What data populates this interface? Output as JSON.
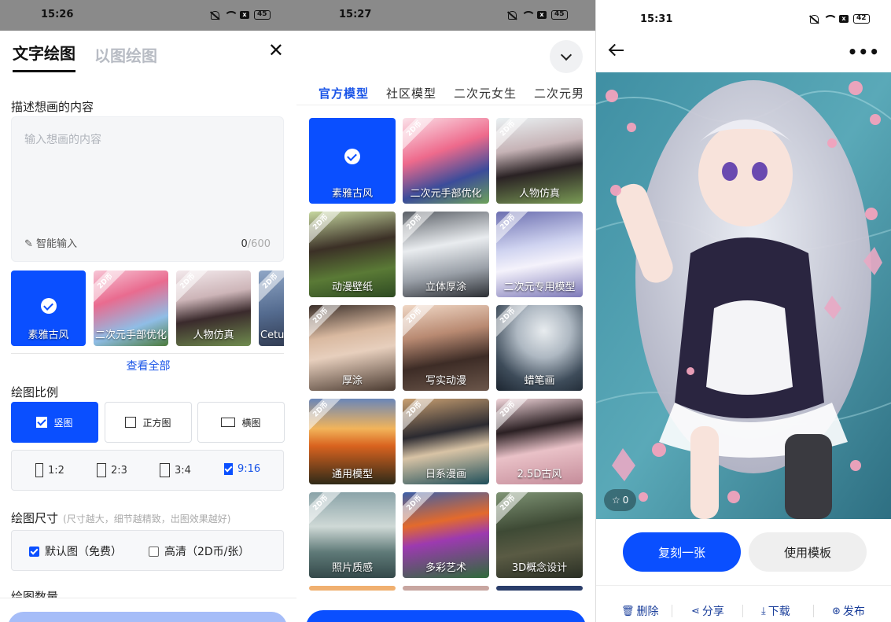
{
  "panel1": {
    "status": {
      "time": "15:26",
      "battery": "45"
    },
    "tabs": [
      "文字绘图",
      "以图绘图"
    ],
    "close_icon": "close-icon",
    "describe_label": "描述想画的内容",
    "input_placeholder": "输入想画的内容",
    "smart_input": "智能输入",
    "char_count": "0",
    "char_max": "/600",
    "models": [
      {
        "name": "素雅古风",
        "selected": true,
        "badge": ""
      },
      {
        "name": "二次元手部优化",
        "selected": false,
        "badge": "2D币"
      },
      {
        "name": "人物仿真",
        "selected": false,
        "badge": "2D币"
      },
      {
        "name": "Cetus",
        "selected": false,
        "badge": "2D币"
      }
    ],
    "view_all": "查看全部",
    "ratio_label": "绘图比例",
    "ratio_options": [
      {
        "label": "竖图",
        "selected": true
      },
      {
        "label": "正方图",
        "selected": false
      },
      {
        "label": "横图",
        "selected": false
      }
    ],
    "sub_ratios": [
      {
        "label": "1:2",
        "selected": false
      },
      {
        "label": "2:3",
        "selected": false
      },
      {
        "label": "3:4",
        "selected": false
      },
      {
        "label": "9:16",
        "selected": true
      }
    ],
    "size_label": "绘图尺寸",
    "size_hint": "(尺寸越大，细节越精致，出图效果越好)",
    "size_options": [
      {
        "label": "默认图（免费）",
        "selected": true
      },
      {
        "label": "高清（2D币/张）",
        "selected": false
      }
    ],
    "count_label": "绘图数量"
  },
  "panel2": {
    "status": {
      "time": "15:27",
      "battery": "45"
    },
    "category_tabs": [
      "官方模型",
      "社区模型",
      "二次元女生",
      "二次元男"
    ],
    "active_tab": "官方模型",
    "models": [
      {
        "name": "素雅古风",
        "badge": "",
        "selected": true
      },
      {
        "name": "二次元手部优化",
        "badge": "2D币",
        "selected": false
      },
      {
        "name": "人物仿真",
        "badge": "2D币",
        "selected": false
      },
      {
        "name": "动漫壁纸",
        "badge": "2D币",
        "selected": false
      },
      {
        "name": "立体厚涂",
        "badge": "2D币",
        "selected": false
      },
      {
        "name": "二次元专用模型",
        "badge": "2D币",
        "selected": false
      },
      {
        "name": "厚涂",
        "badge": "2D币",
        "selected": false
      },
      {
        "name": "写实动漫",
        "badge": "2D币",
        "selected": false
      },
      {
        "name": "蜡笔画",
        "badge": "2D币",
        "selected": false
      },
      {
        "name": "通用模型",
        "badge": "2D币",
        "selected": false
      },
      {
        "name": "日系漫画",
        "badge": "2D币",
        "selected": false
      },
      {
        "name": "2.5D古风",
        "badge": "2D币",
        "selected": false
      },
      {
        "name": "照片质感",
        "badge": "2D币",
        "selected": false
      },
      {
        "name": "多彩艺术",
        "badge": "2D币",
        "selected": false
      },
      {
        "name": "3D概念设计",
        "badge": "2D币",
        "selected": false
      }
    ]
  },
  "panel3": {
    "status": {
      "time": "15:31",
      "battery": "42"
    },
    "likes": "0",
    "primary_button": "复刻一张",
    "secondary_button": "使用模板",
    "actions": [
      {
        "label": "删除",
        "icon": "trash-icon"
      },
      {
        "label": "分享",
        "icon": "share-icon"
      },
      {
        "label": "下载",
        "icon": "download-icon"
      },
      {
        "label": "发布",
        "icon": "publish-icon"
      }
    ]
  },
  "colors": {
    "accent": "#0a4fff",
    "link": "#1a55e8",
    "muted": "#b8bcc4"
  }
}
